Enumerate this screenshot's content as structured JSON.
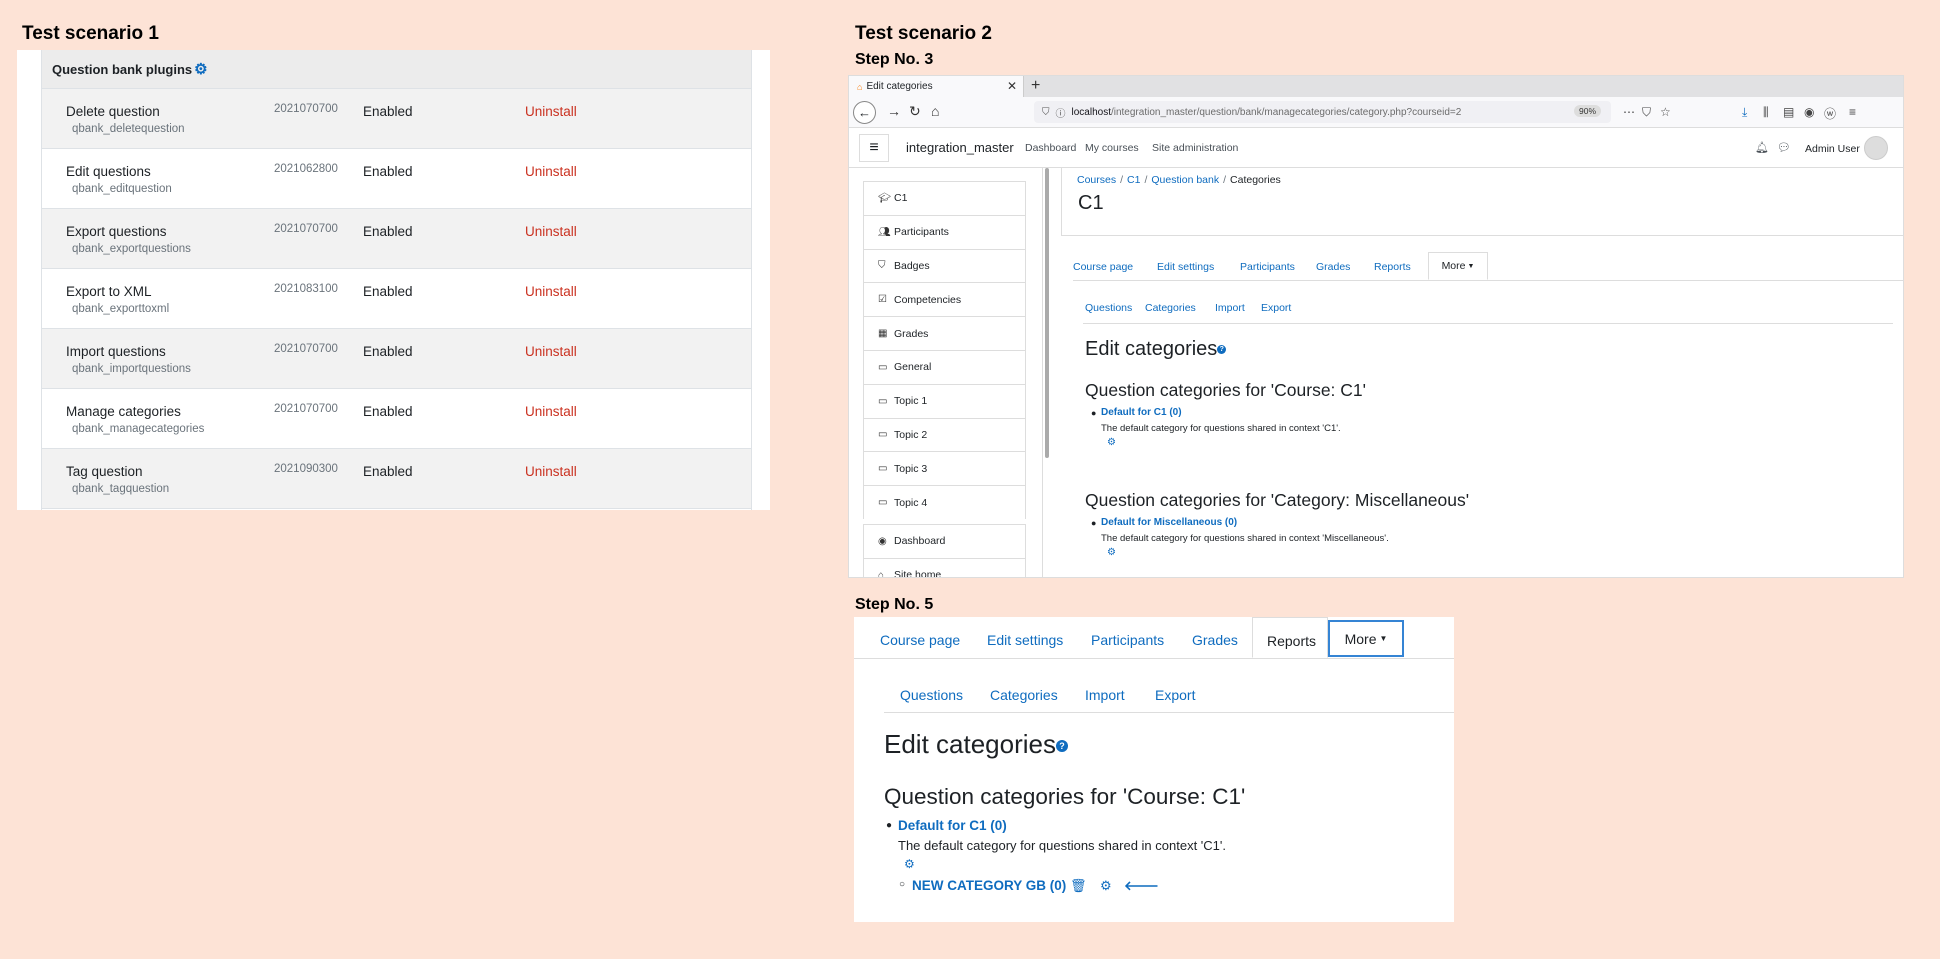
{
  "scenario1": {
    "heading": "Test scenario 1",
    "section_title": "Question bank plugins",
    "plugins": [
      {
        "name": "Delete question",
        "code": "qbank_deletequestion",
        "version": "2021070700",
        "status": "Enabled",
        "action": "Uninstall"
      },
      {
        "name": "Edit questions",
        "code": "qbank_editquestion",
        "version": "2021062800",
        "status": "Enabled",
        "action": "Uninstall"
      },
      {
        "name": "Export questions",
        "code": "qbank_exportquestions",
        "version": "2021070700",
        "status": "Enabled",
        "action": "Uninstall"
      },
      {
        "name": "Export to XML",
        "code": "qbank_exporttoxml",
        "version": "2021083100",
        "status": "Enabled",
        "action": "Uninstall"
      },
      {
        "name": "Import questions",
        "code": "qbank_importquestions",
        "version": "2021070700",
        "status": "Enabled",
        "action": "Uninstall"
      },
      {
        "name": "Manage categories",
        "code": "qbank_managecategories",
        "version": "2021070700",
        "status": "Enabled",
        "action": "Uninstall"
      },
      {
        "name": "Tag question",
        "code": "qbank_tagquestion",
        "version": "2021090300",
        "status": "Enabled",
        "action": "Uninstall"
      }
    ]
  },
  "scenario2": {
    "heading": "Test scenario 2",
    "step3": "Step No. 3",
    "step5": "Step No. 5",
    "browser": {
      "tab_title": "Edit categories",
      "url_host": "localhost",
      "url_path": "/integration_master/question/bank/managecategories/category.php?courseid=2",
      "zoom": "90%"
    },
    "header": {
      "site_name": "integration_master",
      "nav": [
        "Dashboard",
        "My courses",
        "Site administration"
      ],
      "user": "Admin User"
    },
    "drawer": [
      "C1",
      "Participants",
      "Badges",
      "Competencies",
      "Grades",
      "General",
      "Topic 1",
      "Topic 2",
      "Topic 3",
      "Topic 4"
    ],
    "drawer2": [
      "Dashboard",
      "Site home"
    ],
    "breadcrumb": [
      "Courses",
      "C1",
      "Question bank",
      "Categories"
    ],
    "course_title": "C1",
    "course_nav": [
      "Course page",
      "Edit settings",
      "Participants",
      "Grades",
      "Reports",
      "More"
    ],
    "sub_nav": [
      "Questions",
      "Categories",
      "Import",
      "Export"
    ],
    "page_heading": "Edit categories",
    "cat_heading_course": "Question categories for 'Course: C1'",
    "default_c1": "Default for C1 (0)",
    "desc_c1": "The default category for questions shared in context 'C1'.",
    "cat_heading_misc": "Question categories for 'Category: Miscellaneous'",
    "default_misc": "Default for Miscellaneous (0)",
    "desc_misc": "The default category for questions shared in context 'Miscellaneous'.",
    "new_category": "NEW CATEGORY GB (0)"
  }
}
